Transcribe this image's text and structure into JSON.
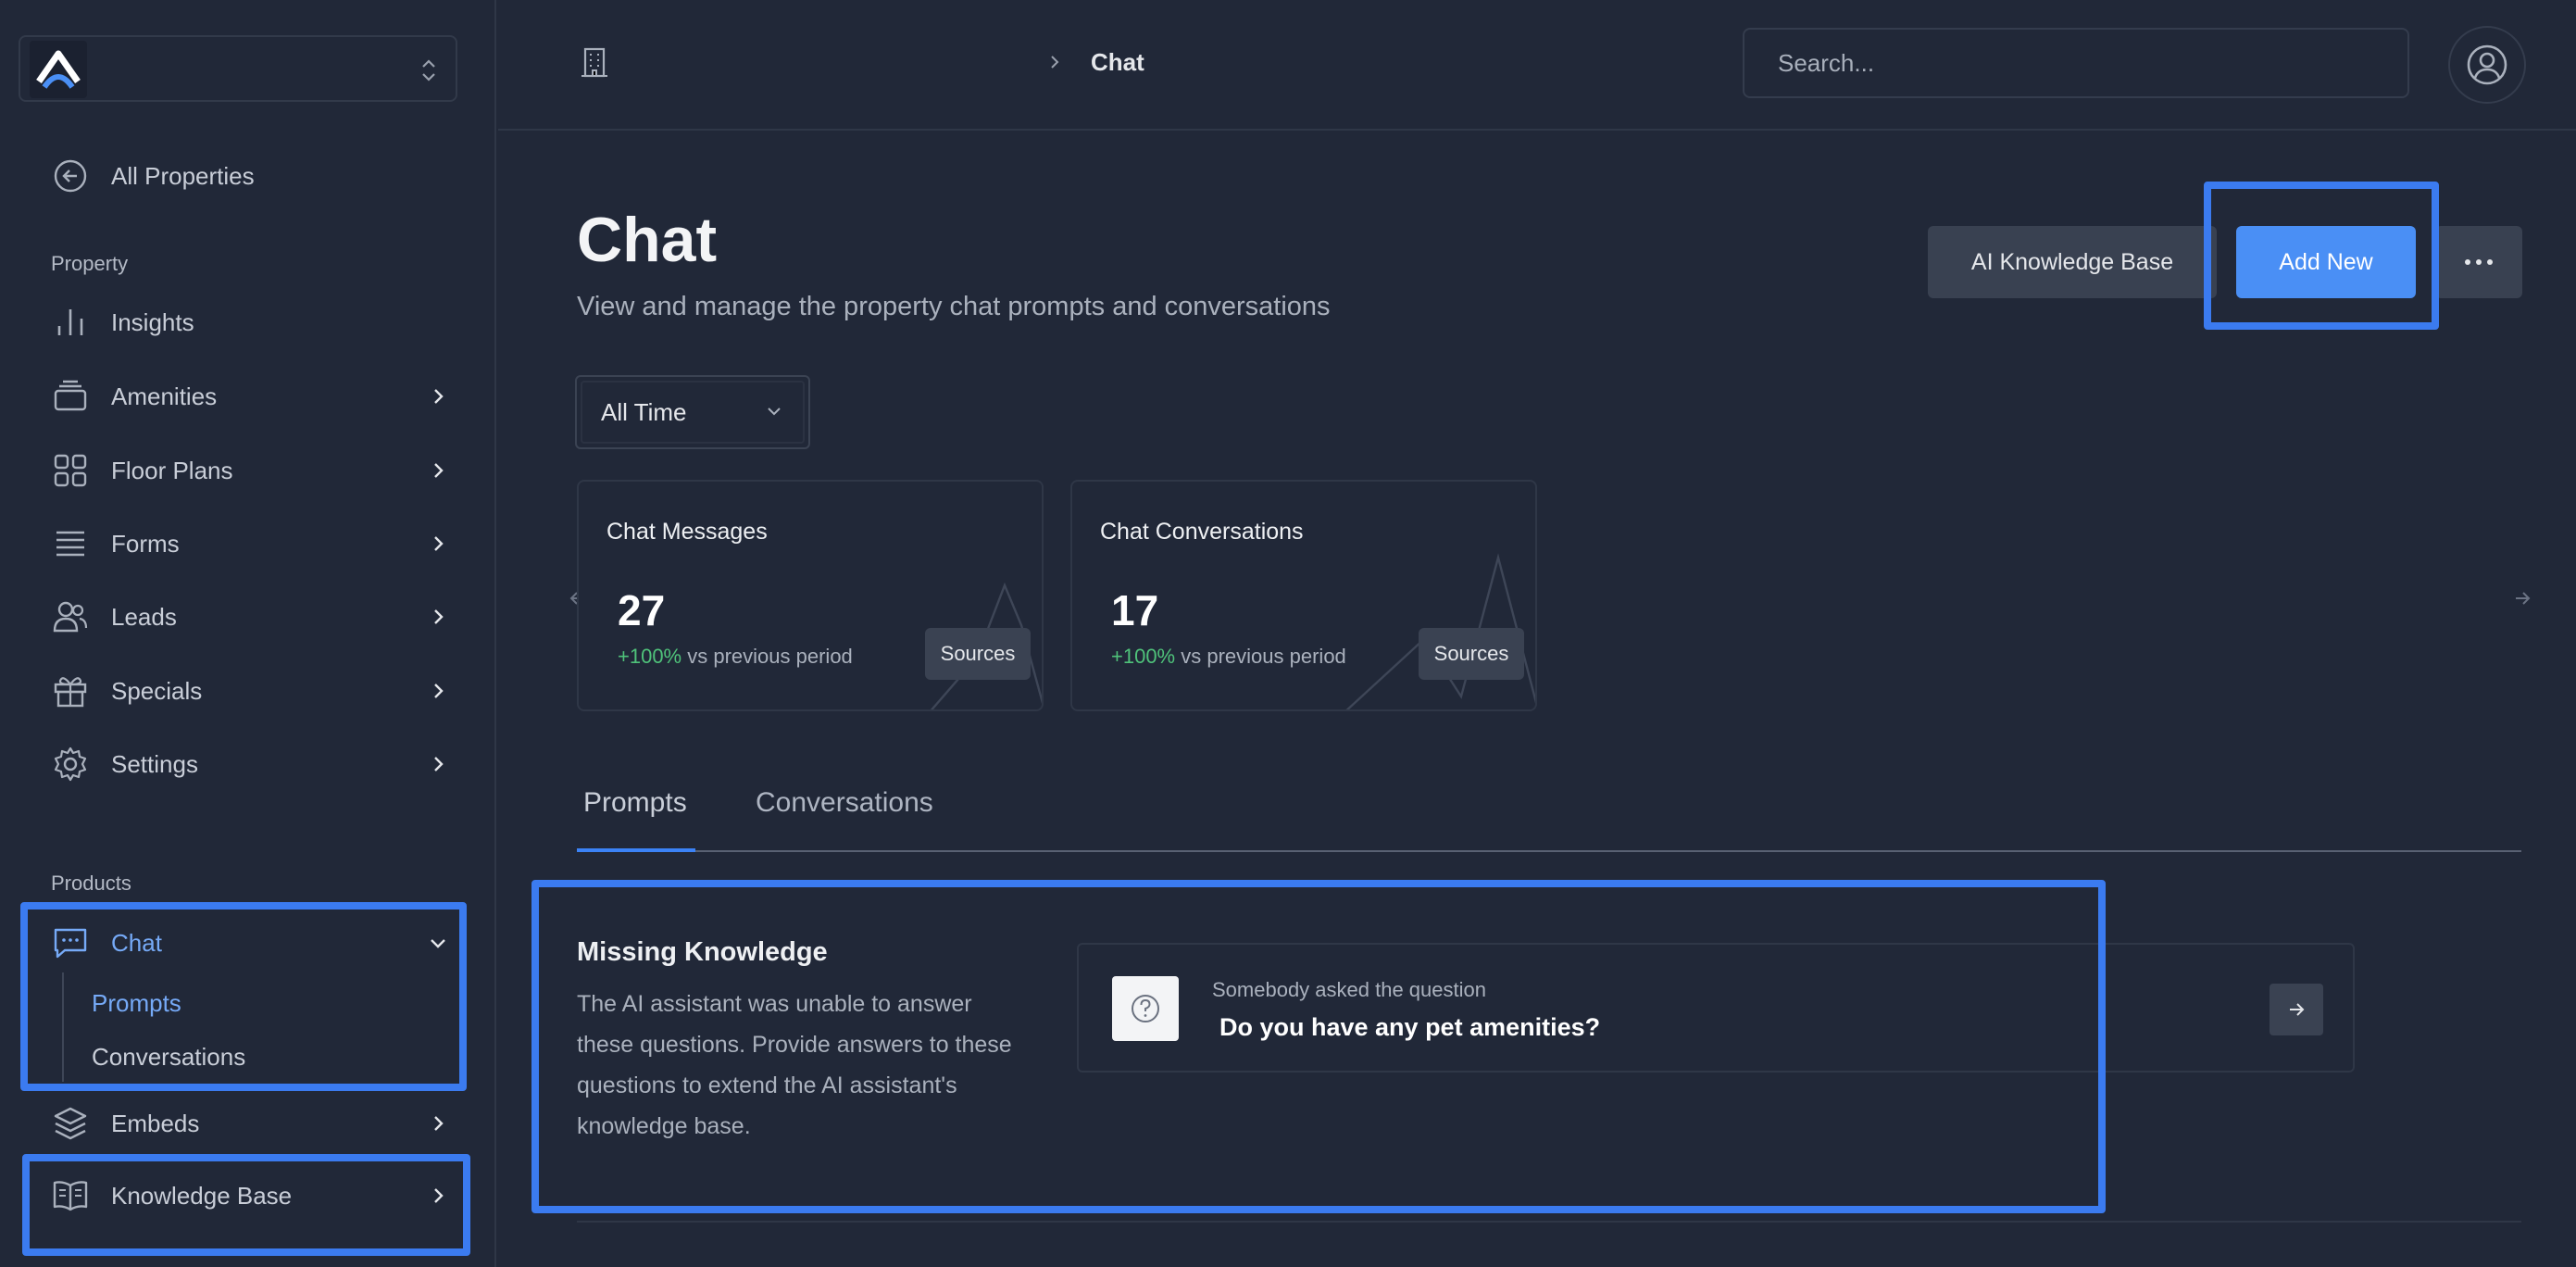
{
  "sidebar": {
    "back_label": "All Properties",
    "section_property": "Property",
    "property_items": [
      {
        "label": "Insights",
        "icon": "bar-chart-icon"
      },
      {
        "label": "Amenities",
        "icon": "stack-icon"
      },
      {
        "label": "Floor Plans",
        "icon": "grid-icon"
      },
      {
        "label": "Forms",
        "icon": "list-icon"
      },
      {
        "label": "Leads",
        "icon": "users-icon"
      },
      {
        "label": "Specials",
        "icon": "gift-icon"
      },
      {
        "label": "Settings",
        "icon": "gear-icon"
      }
    ],
    "section_products": "Products",
    "chat": {
      "label": "Chat",
      "sub_items": [
        "Prompts",
        "Conversations"
      ]
    },
    "embeds_label": "Embeds",
    "knowledge_base_label": "Knowledge Base"
  },
  "topbar": {
    "breadcrumb_current": "Chat",
    "search_placeholder": "Search..."
  },
  "header": {
    "title": "Chat",
    "subtitle": "View and manage the property chat prompts and conversations",
    "kb_button": "AI Knowledge Base",
    "add_button": "Add New"
  },
  "filter": {
    "selected": "All Time"
  },
  "stats": [
    {
      "title": "Chat Messages",
      "value": "27",
      "change": "+100%",
      "change_text": "vs previous period",
      "sources": "Sources"
    },
    {
      "title": "Chat Conversations",
      "value": "17",
      "change": "+100%",
      "change_text": "vs previous period",
      "sources": "Sources"
    }
  ],
  "tabs": [
    "Prompts",
    "Conversations"
  ],
  "missing_knowledge": {
    "title": "Missing Knowledge",
    "description": "The AI assistant was unable to answer these questions. Provide answers to these questions to extend the AI assistant's knowledge base.",
    "question_caption": "Somebody asked the question",
    "question": "Do you have any pet amenities?"
  },
  "colors": {
    "background": "#212838",
    "accent": "#4a8ff5",
    "highlight": "#3b7bf0",
    "positive": "#4fc27a"
  }
}
